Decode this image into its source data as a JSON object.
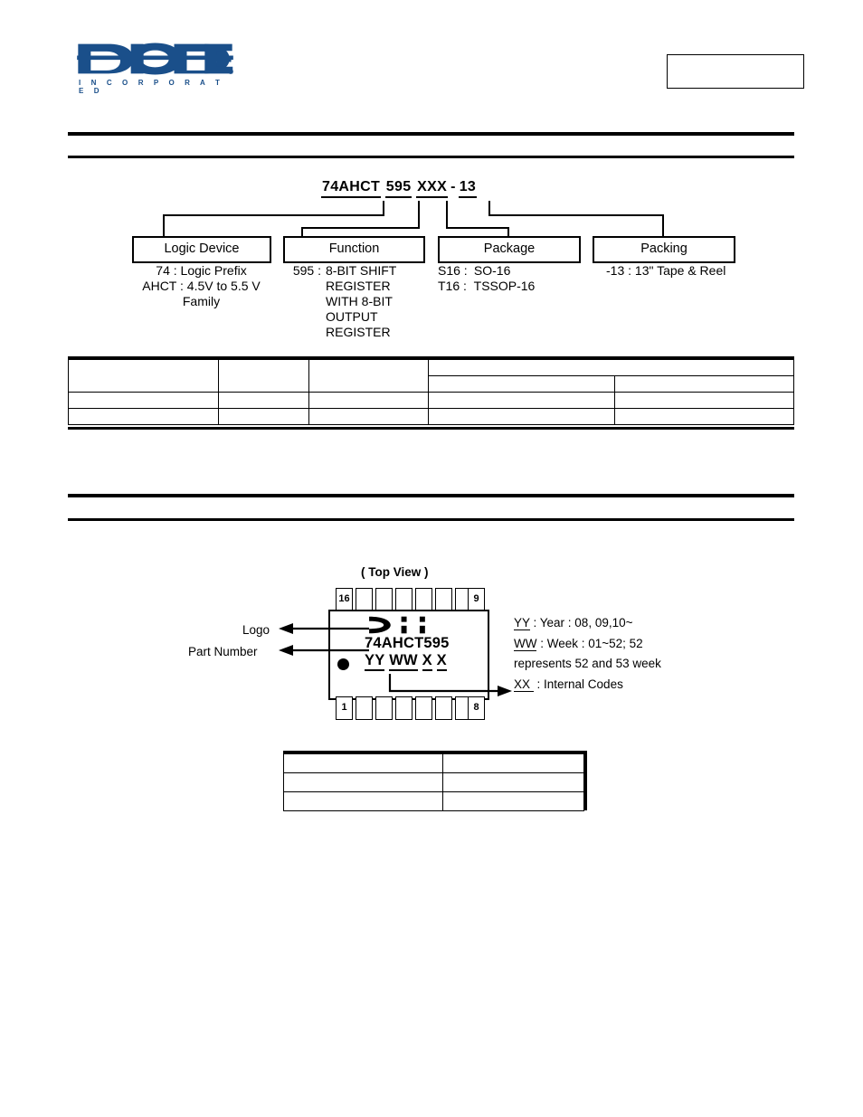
{
  "header": {
    "logo_name": "diodes-incorporated-logo",
    "logo_wordmark": "DIODES",
    "logo_subtitle": "I N C O R P O R A T E D",
    "logo_color": "#1a4f8a",
    "part_box_value": ""
  },
  "sections": {
    "ordering_information": "",
    "marking_information": ""
  },
  "ordering": {
    "part_number": {
      "logic": "74AHCT",
      "function": "595",
      "package": "XXX",
      "dash": "-",
      "packing": "13"
    },
    "categories": [
      {
        "box_label": "Logic Device",
        "lines": [
          {
            "key": "74 :",
            "value": "Logic Prefix"
          },
          {
            "key": "AHCT  :",
            "value": "4.5V to 5.5 V"
          },
          {
            "key": "",
            "value": "Family"
          }
        ]
      },
      {
        "box_label": "Function",
        "lines": [
          {
            "key": "595 :",
            "value": "8-BIT SHIFT"
          },
          {
            "key": "",
            "value": "REGISTER"
          },
          {
            "key": "",
            "value": "WITH 8-BIT"
          },
          {
            "key": "",
            "value": "OUTPUT"
          },
          {
            "key": "",
            "value": "REGISTER"
          }
        ]
      },
      {
        "box_label": "Package",
        "lines": [
          {
            "key": "S16 :",
            "value": "SO-16"
          },
          {
            "key": "T16 :",
            "value": "TSSOP-16"
          }
        ]
      },
      {
        "box_label": "Packing",
        "lines": [
          {
            "key": "-13 :",
            "value": "13\" Tape & Reel"
          }
        ]
      }
    ]
  },
  "ordering_table": {
    "rows": [
      [
        "",
        "",
        "",
        "",
        ""
      ],
      [
        "",
        "",
        "",
        "",
        ""
      ],
      [
        "",
        "",
        "",
        "",
        ""
      ]
    ]
  },
  "marking": {
    "top_view_label": "( Top View )",
    "leaders": {
      "logo": "Logo",
      "part_number": "Part Number"
    },
    "package": {
      "pin_top_left": "16",
      "pin_top_right": "9",
      "pin_bottom_left": "1",
      "pin_bottom_right": "8",
      "top_pin_count": 8,
      "bottom_pin_count": 8,
      "logo_glyph": "diodes-chip-logo",
      "part_number": "74AHCT595",
      "date_code": "YY WW X X"
    },
    "legend": [
      {
        "code": "YY",
        "text": " : Year : 08, 09,10~"
      },
      {
        "code": "WW",
        "text": " : Week : 01~52; 52"
      },
      {
        "code": "",
        "text": "represents 52 and 53 week"
      },
      {
        "code": "XX ",
        "text": " :  Internal Codes"
      }
    ]
  },
  "marking_table": {
    "rows": [
      [
        "",
        ""
      ],
      [
        "",
        ""
      ],
      [
        "",
        ""
      ]
    ]
  }
}
